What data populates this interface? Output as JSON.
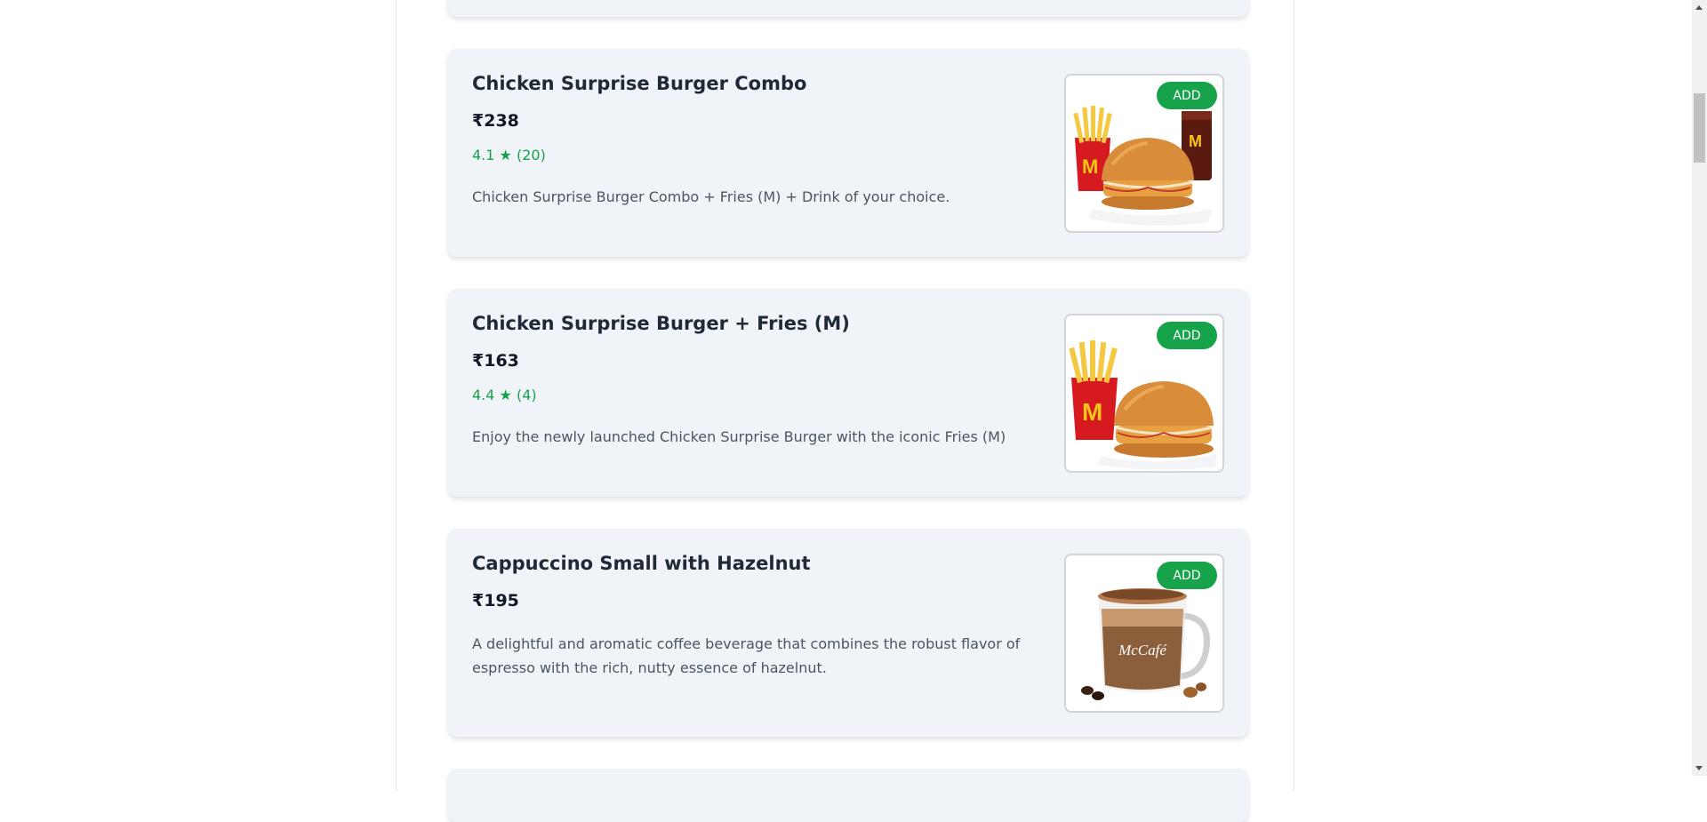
{
  "menu": {
    "items": [
      {
        "title": "Chicken Surprise Burger Combo",
        "price": "₹238",
        "rating": "4.1 ★ (20)",
        "description": "Chicken Surprise Burger Combo + Fries (M) + Drink of your choice.",
        "add_label": "ADD",
        "image": "burger-fries-drink-image"
      },
      {
        "title": "Chicken Surprise Burger + Fries (M)",
        "price": "₹163",
        "rating": "4.4 ★ (4)",
        "description": "Enjoy the newly launched Chicken Surprise Burger with the iconic Fries (M)",
        "add_label": "ADD",
        "image": "burger-fries-image"
      },
      {
        "title": "Cappuccino Small with Hazelnut",
        "price": "₹195",
        "rating": "",
        "description": "A delightful and aromatic coffee beverage that combines the robust flavor of espresso with the rich, nutty essence of hazelnut.",
        "add_label": "ADD",
        "image": "cappuccino-image",
        "mug_brand": "McCafé"
      }
    ]
  },
  "colors": {
    "accent_green": "#16a34a",
    "card_bg": "#f0f3f7"
  }
}
